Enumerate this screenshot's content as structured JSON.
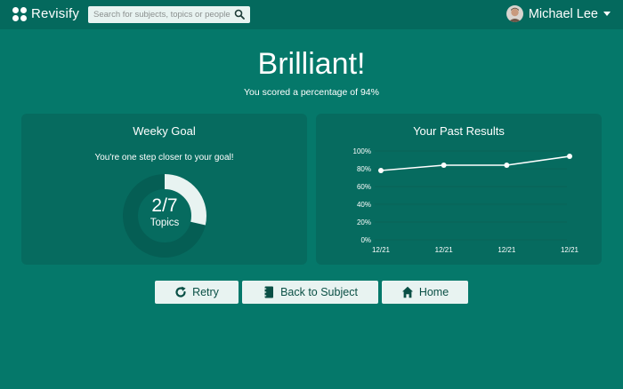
{
  "app": {
    "name": "Revisify"
  },
  "search": {
    "placeholder": "Search for subjects, topics or people"
  },
  "user": {
    "name": "Michael Lee"
  },
  "result": {
    "headline": "Brilliant!",
    "summary": "You scored a percentage of 94%"
  },
  "weekly_goal": {
    "title": "Weeky Goal",
    "message": "You're one step closer to your goal!",
    "fraction_label": "2/7",
    "unit_label": "Topics",
    "progress": 0.2857
  },
  "past_results": {
    "title": "Your Past Results"
  },
  "chart_data": {
    "type": "line",
    "title": "Your Past Results",
    "x": [
      "12/21",
      "12/21",
      "12/21",
      "12/21"
    ],
    "series": [
      {
        "values": [
          78,
          84,
          84,
          94
        ]
      }
    ],
    "ylim": [
      0,
      100
    ],
    "y_ticks": [
      "0%",
      "20%",
      "40%",
      "60%",
      "80%",
      "100%"
    ],
    "grid": true
  },
  "actions": {
    "retry": "Retry",
    "back": "Back to Subject",
    "home": "Home"
  },
  "colors": {
    "background": "#05786a",
    "topbar": "#04695d",
    "card": "#066b5f",
    "accent_light": "#e8f3f1",
    "button_text": "#0a4f45"
  },
  "icons": {
    "logo": "four-dots-logo",
    "search": "search-icon",
    "retry": "refresh-icon",
    "back": "notebook-icon",
    "home": "home-icon"
  }
}
